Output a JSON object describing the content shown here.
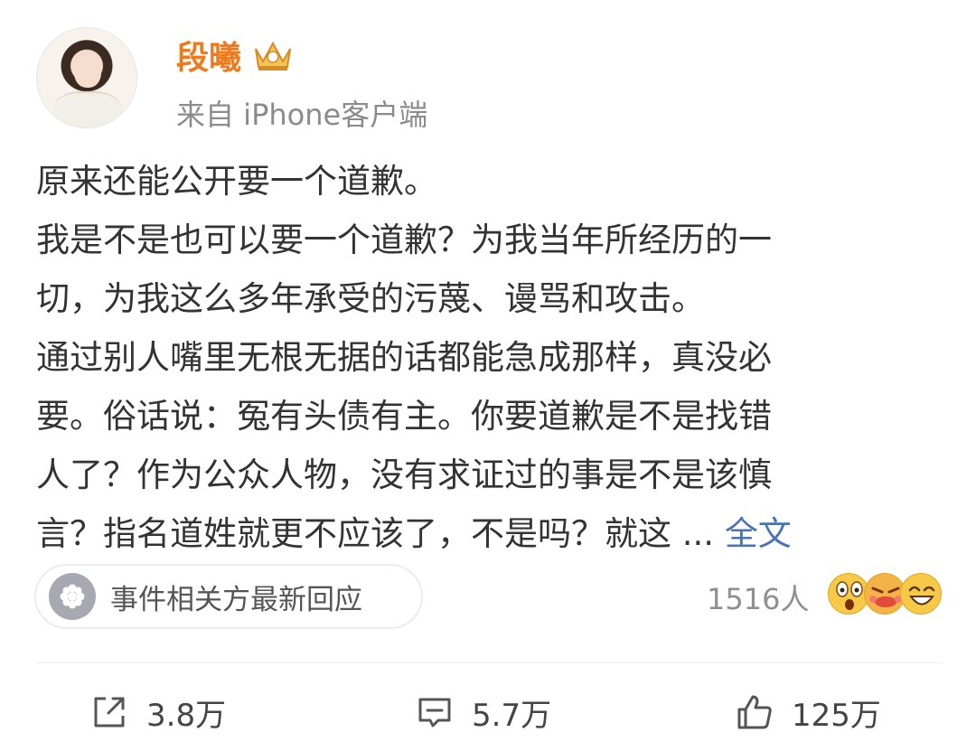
{
  "user": {
    "name": "段曦",
    "source": "来自 iPhone客户端"
  },
  "post": {
    "lines": [
      "原来还能公开要一个道歉。",
      "我是不是也可以要一个道歉？为我当年所经历的一",
      "切，为我这么多年承受的污蔑、谩骂和攻击。",
      "通过别人嘴里无根无据的话都能急成那样，真没必",
      "要。俗话说：冤有头债有主。你要道歉是不是找错",
      "人了？作为公众人物，没有求证过的事是不是该慎"
    ],
    "last_line": "言？指名道姓就更不应该了，不是吗？就这 ...",
    "full_text_link": "全文"
  },
  "topic": {
    "label": "事件相关方最新回应",
    "icon": "flower-icon"
  },
  "reactions": {
    "count": "1516人",
    "emojis": [
      "shocked-emoji-icon",
      "angry-emoji-icon",
      "laughing-emoji-icon"
    ]
  },
  "actions": {
    "share": "3.8万",
    "comment": "5.7万",
    "like": "125万"
  },
  "colors": {
    "name": "#f07a19",
    "link": "#4a73b5",
    "muted": "#8b8b8b"
  }
}
